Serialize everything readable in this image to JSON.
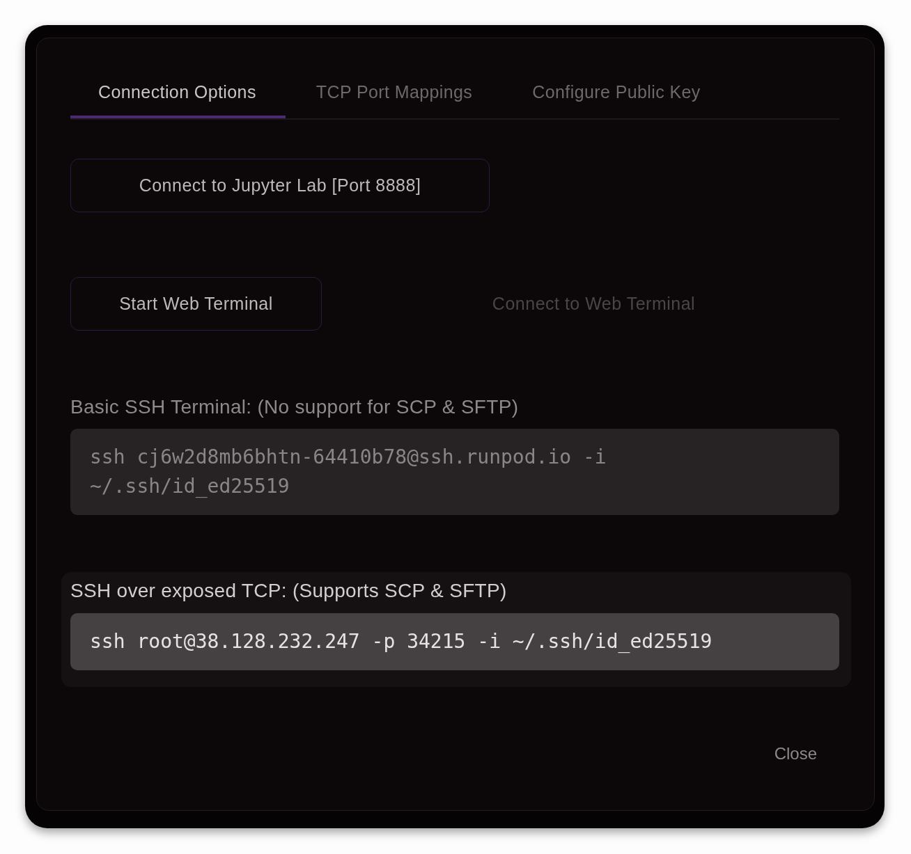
{
  "tabs": [
    {
      "label": "Connection Options",
      "selected": true
    },
    {
      "label": "TCP Port Mappings",
      "selected": false
    },
    {
      "label": "Configure Public Key",
      "selected": false
    }
  ],
  "button_rows": [
    {
      "buttons": [
        {
          "label": "Connect to Jupyter Lab [Port 8888]",
          "disabled": false
        }
      ]
    },
    {
      "buttons": [
        {
          "label": "Start Web Terminal",
          "disabled": false
        },
        {
          "label": "Connect to Web Terminal",
          "disabled": true
        }
      ]
    }
  ],
  "sections": [
    {
      "label": "Basic SSH Terminal: (No support for SCP & SFTP)",
      "command": "ssh cj6w2d8mb6bhtn-64410b78@ssh.runpod.io -i ~/.ssh/id_ed25519",
      "highlighted": false
    },
    {
      "label": "SSH over exposed TCP: (Supports SCP & SFTP)",
      "command": "ssh root@38.128.232.247 -p 34215 -i ~/.ssh/id_ed25519",
      "highlighted": true
    }
  ],
  "close_button": {
    "label": "Close"
  }
}
